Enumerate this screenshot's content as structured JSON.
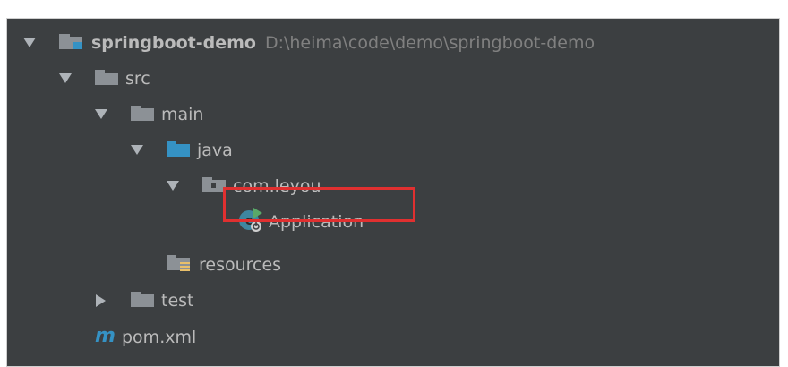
{
  "tree": {
    "root": {
      "label": "springboot-demo",
      "path": "D:\\heima\\code\\demo\\springboot-demo"
    },
    "src": {
      "label": "src"
    },
    "main": {
      "label": "main"
    },
    "java": {
      "label": "java"
    },
    "package": {
      "label": "com.leyou"
    },
    "application": {
      "label": "Application"
    },
    "resources": {
      "label": "resources"
    },
    "test": {
      "label": "test"
    },
    "pom": {
      "label": "pom.xml"
    }
  },
  "colors": {
    "background": "#3c3f41",
    "text": "#bbbbbb",
    "path_text": "#808080",
    "folder": "#8c9196",
    "source_folder": "#3592c4",
    "highlight": "#e03030"
  }
}
